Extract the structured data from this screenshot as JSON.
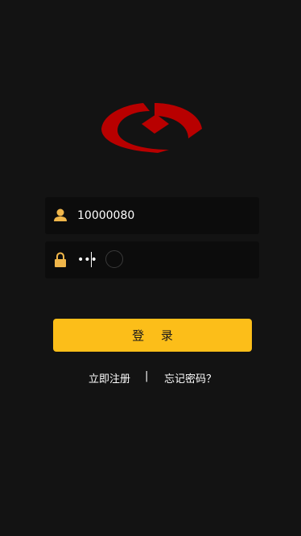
{
  "logo": {
    "icon": "bank-logo-icon",
    "color": "#c00000"
  },
  "login_form": {
    "username": {
      "icon": "user-icon",
      "value": "10000080"
    },
    "password": {
      "icon": "lock-icon",
      "value": "•••"
    },
    "submit_label": "登 录"
  },
  "links": {
    "register": "立即注册",
    "separator": "|",
    "forgot_password": "忘记密码？"
  },
  "colors": {
    "background": "#131313",
    "field_background": "#0c0c0c",
    "accent": "#fcbe19",
    "icon": "#f0b64a"
  }
}
